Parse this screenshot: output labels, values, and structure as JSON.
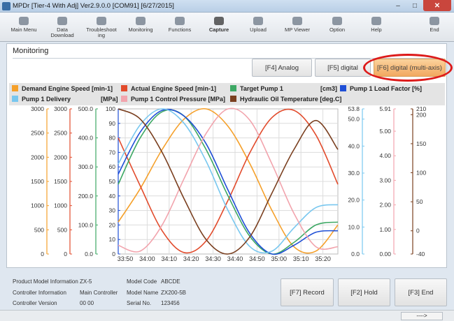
{
  "window": {
    "title": "MPDr [Tier-4 With Adj] Ver2.9.0.0 [COM91] [6/27/2015]"
  },
  "toolbar": [
    {
      "label": "Main Menu",
      "icon": "home-icon"
    },
    {
      "label": "Data\nDownload",
      "icon": "download-icon"
    },
    {
      "label": "Troubleshoot\ning",
      "icon": "wrench-icon"
    },
    {
      "label": "Monitoring",
      "icon": "gauge-icon"
    },
    {
      "label": "Functions",
      "icon": "functions-icon"
    },
    {
      "label": "Capture",
      "icon": "camera-icon"
    },
    {
      "label": "Upload",
      "icon": "upload-icon"
    },
    {
      "label": "MP Viewer",
      "icon": "viewer-icon"
    },
    {
      "label": "Option",
      "icon": "option-icon"
    },
    {
      "label": "Help",
      "icon": "help-icon"
    },
    {
      "label": "End",
      "icon": "power-icon"
    }
  ],
  "panel": {
    "title": "Monitoring",
    "tabs": {
      "f4": "[F4] Analog",
      "f5": "[F5] digital",
      "f6": "[F6] digital (multi-axis)"
    }
  },
  "legend": {
    "items": [
      {
        "label": "Demand Engine Speed  [min-1]",
        "color": "#f5a02a"
      },
      {
        "label": "Actual Engine Speed  [min-1]",
        "color": "#e24b2c"
      },
      {
        "label": "Target Pump 1",
        "color": "#3da864"
      },
      {
        "label": "Pump 1 Load Factor  [%]",
        "color": "#1f4fd6"
      },
      {
        "label": "Pump 1 Delivery",
        "color": "#78c7ef"
      },
      {
        "label": "Pump 1 Control Pressure  [MPa]",
        "color": "#f2a4ad"
      },
      {
        "label": "Hydraulic Oil Temperature  [deg.C]",
        "color": "#7a3f1f"
      }
    ],
    "units": {
      "target_pump": "[cm3]",
      "delivery": "[MPa]"
    }
  },
  "chart_data": {
    "type": "line",
    "x_ticks": [
      "33:50",
      "34:00",
      "34:10",
      "34:20",
      "34:30",
      "34:40",
      "34:50",
      "35:00",
      "35:10",
      "35:20"
    ],
    "axes": {
      "engine_demand": {
        "ticks": [
          "3000",
          "2500",
          "2000",
          "1500",
          "1000",
          "500",
          "0"
        ],
        "color": "#f5a02a"
      },
      "engine_actual": {
        "ticks": [
          "3000",
          "2500",
          "2000",
          "1500",
          "1000",
          "500",
          "0"
        ],
        "color": "#e24b2c"
      },
      "target_pump": {
        "ticks": [
          "500.0",
          "400.0",
          "300.0",
          "200.0",
          "100.0",
          "0.0"
        ],
        "color": "#3da864"
      },
      "load_factor": {
        "ticks": [
          "100",
          "90",
          "80",
          "70",
          "60",
          "50",
          "40",
          "30",
          "20",
          "10",
          "0"
        ],
        "color": "#1f4fd6"
      },
      "delivery": {
        "ticks": [
          "53.8",
          "50.0",
          "40.0",
          "30.0",
          "20.0",
          "10.0",
          "0.0"
        ],
        "color": "#78c7ef"
      },
      "control_pressure": {
        "ticks": [
          "5.91",
          "5.00",
          "4.00",
          "3.00",
          "2.00",
          "1.00",
          "0.00"
        ],
        "color": "#f2a4ad"
      },
      "oil_temp": {
        "ticks": [
          "210",
          "200",
          "150",
          "100",
          "50",
          "0",
          "-40"
        ],
        "color": "#7a3f1f"
      }
    },
    "ylim_percent": [
      0,
      100
    ],
    "series": [
      {
        "name": "Demand Engine Speed",
        "color": "#f5a02a",
        "y_pct": [
          22,
          45,
          72,
          93,
          100,
          88,
          62,
          30,
          5,
          2,
          20
        ]
      },
      {
        "name": "Actual Engine Speed",
        "color": "#e24b2c",
        "y_pct": [
          80,
          47,
          16,
          1,
          9,
          37,
          70,
          94,
          99,
          82,
          48
        ]
      },
      {
        "name": "Target Pump 1",
        "color": "#3da864",
        "y_pct": [
          48,
          80,
          98,
          95,
          72,
          40,
          12,
          0,
          8,
          20,
          22
        ]
      },
      {
        "name": "Pump 1 Load Factor",
        "color": "#1f4fd6",
        "y_pct": [
          55,
          84,
          99,
          95,
          76,
          44,
          14,
          0,
          6,
          15,
          16
        ]
      },
      {
        "name": "Pump 1 Delivery",
        "color": "#78c7ef",
        "y_pct": [
          62,
          89,
          100,
          90,
          64,
          30,
          5,
          2,
          18,
          32,
          34
        ]
      },
      {
        "name": "Pump 1 Control Pressure",
        "color": "#f2a4ad",
        "y_pct": [
          6,
          2,
          20,
          52,
          83,
          100,
          92,
          62,
          28,
          5,
          5
        ]
      },
      {
        "name": "Hydraulic Oil Temperature",
        "color": "#7a3f1f",
        "y_pct": [
          100,
          93,
          70,
          38,
          10,
          0,
          12,
          42,
          72,
          92,
          72
        ]
      }
    ]
  },
  "info": {
    "product_model_info_label": "Product Model Information",
    "product_model_info_value": "ZX-5",
    "model_code_label": "Model Code",
    "model_code_value": "ABCDE",
    "controller_info_label": "Controller Information",
    "controller_info_value": "Main Controller",
    "model_name_label": "Model Name",
    "model_name_value": "ZX200-5B",
    "controller_version_label": "Controller Version",
    "controller_version_value": "00 00",
    "serial_label": "Serial No.",
    "serial_value": "123456"
  },
  "buttons": {
    "f7": "[F7] Record",
    "f2": "[F2] Hold",
    "f3": "[F3] End"
  },
  "status": {
    "arrow": "---->"
  },
  "colors": {
    "highlight": "#dd1a1a",
    "active_tab": "#f2a960"
  }
}
